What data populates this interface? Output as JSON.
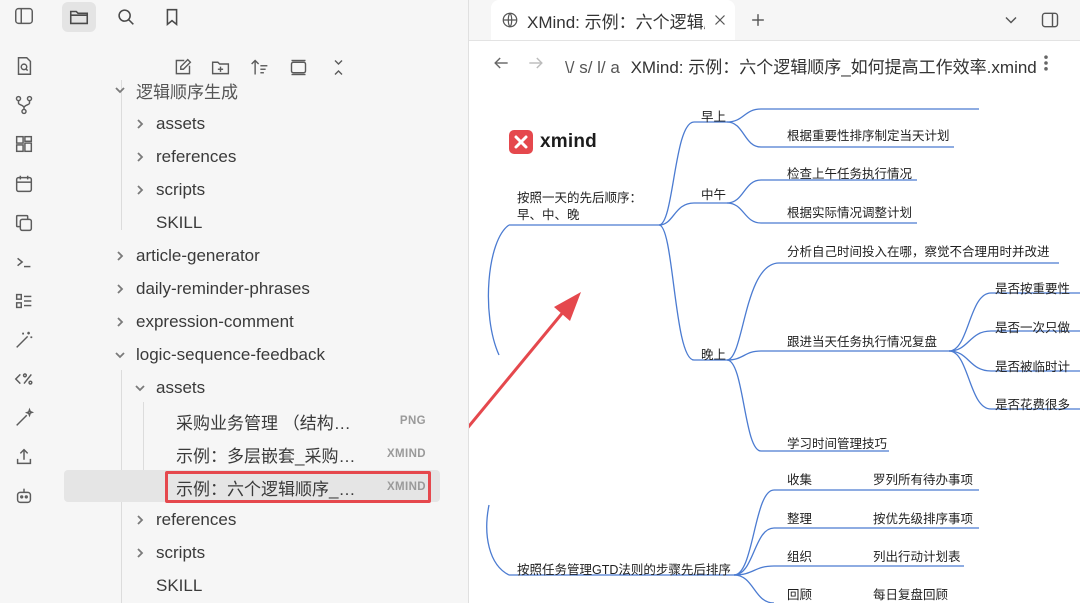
{
  "sidebar": {
    "tree": [
      {
        "label": "逻辑顺序生成",
        "depth": 0,
        "chevron": "down",
        "top": 0
      },
      {
        "label": "assets",
        "chevron": "right"
      },
      {
        "label": "references",
        "chevron": "right"
      },
      {
        "label": "scripts",
        "chevron": "right"
      },
      {
        "label": "SKILL"
      },
      {
        "label": "article-generator",
        "chevron": "right"
      },
      {
        "label": "daily-reminder-phrases",
        "chevron": "right"
      },
      {
        "label": "expression-comment",
        "chevron": "right"
      },
      {
        "label": "logic-sequence-feedback",
        "chevron": "down"
      },
      {
        "label": "assets",
        "chevron": "down"
      },
      {
        "label": "采购业务管理 （结构顺序：...",
        "badge": "PNG"
      },
      {
        "label": "示例：多层嵌套_采购中心...",
        "badge": "XMIND"
      },
      {
        "label": "示例：六个逻辑顺序_如何...",
        "badge": "XMIND"
      },
      {
        "label": "references",
        "chevron": "right"
      },
      {
        "label": "scripts",
        "chevron": "right"
      },
      {
        "label": "SKILL"
      }
    ]
  },
  "tab": {
    "title": "XMind: 示例：六个逻辑顺序_如何提高工作效率"
  },
  "breadcrumb": {
    "parts": [
      "\\/",
      "s/",
      "l/",
      "a"
    ],
    "file": "XMind: 示例：六个逻辑顺序_如何提高工作效率.xmind"
  },
  "mindmap": {
    "logo_word": "xmind",
    "branch1": "按照一天的先后顺序：",
    "branch1_line2": "早、中、晚",
    "morning": "早上",
    "morning_1": "根据重要性排序制定当天计划",
    "noon": "中午",
    "noon_1": "检查上午任务执行情况",
    "noon_2": "根据实际情况调整计划",
    "evening": "晚上",
    "evening_1": "分析自己时间投入在哪，察觉不合理用时并改进",
    "evening_2": "跟进当天任务执行情况复盘",
    "evening_2a": "是否按重要性",
    "evening_2b": "是否一次只做",
    "evening_2c": "是否被临时计",
    "evening_2d": "是否花费很多",
    "evening_3": "学习时间管理技巧",
    "branch2": "按照任务管理GTD法则的步骤先后排序",
    "gtd": [
      {
        "step": "收集",
        "detail": "罗列所有待办事项"
      },
      {
        "step": "整理",
        "detail": "按优先级排序事项"
      },
      {
        "step": "组织",
        "detail": "列出行动计划表"
      },
      {
        "step": "回顾",
        "detail": "每日复盘回顾"
      }
    ]
  },
  "colors": {
    "accent": "#e5484d",
    "mm_line": "#4b7bd1"
  }
}
